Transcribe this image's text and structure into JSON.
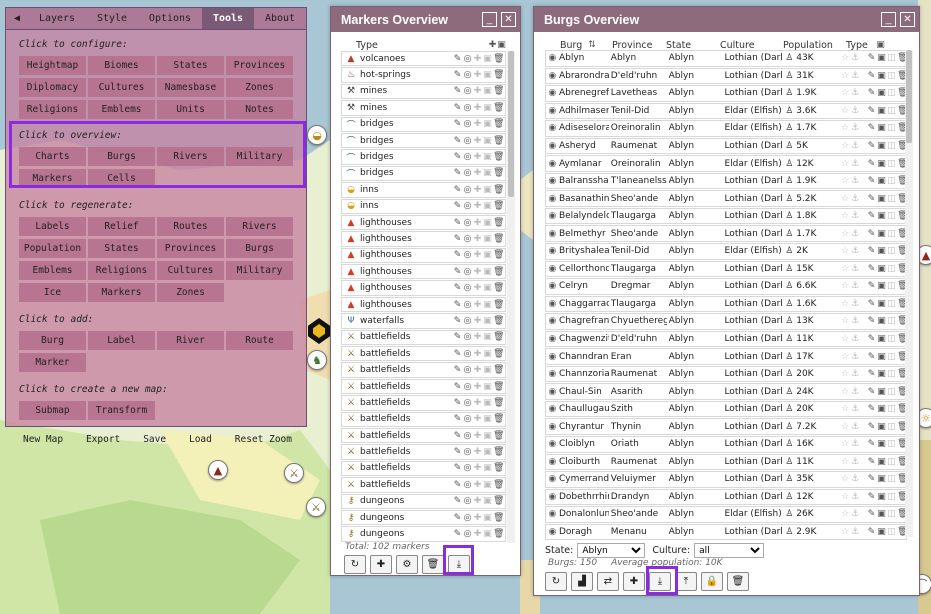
{
  "tools": {
    "tabs": [
      {
        "label": "◀"
      },
      {
        "label": "Layers"
      },
      {
        "label": "Style"
      },
      {
        "label": "Options"
      },
      {
        "label": "Tools"
      },
      {
        "label": "About"
      }
    ],
    "configure_title": "Click to configure:",
    "configure": [
      "Heightmap",
      "Biomes",
      "States",
      "Provinces",
      "Diplomacy",
      "Cultures",
      "Namesbase",
      "Zones",
      "Religions",
      "Emblems",
      "Units",
      "Notes"
    ],
    "overview_title": "Click to overview:",
    "overview": [
      "Charts",
      "Burgs",
      "Rivers",
      "Military",
      "Markers",
      "Cells"
    ],
    "regenerate_title": "Click to regenerate:",
    "regenerate": [
      "Labels",
      "Relief",
      "Routes",
      "Rivers",
      "Population",
      "States",
      "Provinces",
      "Burgs",
      "Emblems",
      "Religions",
      "Cultures",
      "Military",
      "Ice",
      "Markers",
      "Zones"
    ],
    "add_title": "Click to add:",
    "add": [
      "Burg",
      "Label",
      "River",
      "Route",
      "Marker"
    ],
    "newmap_title": "Click to create a new map:",
    "newmap": [
      "Submap",
      "Transform"
    ],
    "bottom": [
      "New Map",
      "Export",
      "Save",
      "Load",
      "Reset Zoom"
    ]
  },
  "markers": {
    "title": "Markers Overview",
    "header_type": "Type",
    "items": [
      {
        "icon": "▲",
        "color": "#c0392b",
        "type": "volcanoes"
      },
      {
        "icon": "♨",
        "color": "#8e2c1e",
        "type": "hot-springs"
      },
      {
        "icon": "⚒",
        "color": "#444444",
        "type": "mines"
      },
      {
        "icon": "⚒",
        "color": "#444444",
        "type": "mines"
      },
      {
        "icon": "⌒",
        "color": "#2c5d7c",
        "type": "bridges"
      },
      {
        "icon": "⌒",
        "color": "#2c5d7c",
        "type": "bridges"
      },
      {
        "icon": "⌒",
        "color": "#2c5d7c",
        "type": "bridges"
      },
      {
        "icon": "⌒",
        "color": "#2c5d7c",
        "type": "bridges"
      },
      {
        "icon": "◒",
        "color": "#d4a017",
        "type": "inns"
      },
      {
        "icon": "◒",
        "color": "#d4a017",
        "type": "inns"
      },
      {
        "icon": "▲",
        "color": "#d33b2c",
        "type": "lighthouses"
      },
      {
        "icon": "▲",
        "color": "#d33b2c",
        "type": "lighthouses"
      },
      {
        "icon": "▲",
        "color": "#d33b2c",
        "type": "lighthouses"
      },
      {
        "icon": "▲",
        "color": "#d33b2c",
        "type": "lighthouses"
      },
      {
        "icon": "▲",
        "color": "#d33b2c",
        "type": "lighthouses"
      },
      {
        "icon": "▲",
        "color": "#d33b2c",
        "type": "lighthouses"
      },
      {
        "icon": "Ψ",
        "color": "#3a6ea5",
        "type": "waterfalls"
      },
      {
        "icon": "⚔",
        "color": "#7a5c2e",
        "type": "battlefields"
      },
      {
        "icon": "⚔",
        "color": "#7a5c2e",
        "type": "battlefields"
      },
      {
        "icon": "⚔",
        "color": "#7a5c2e",
        "type": "battlefields"
      },
      {
        "icon": "⚔",
        "color": "#7a5c2e",
        "type": "battlefields"
      },
      {
        "icon": "⚔",
        "color": "#7a5c2e",
        "type": "battlefields"
      },
      {
        "icon": "⚔",
        "color": "#7a5c2e",
        "type": "battlefields"
      },
      {
        "icon": "⚔",
        "color": "#7a5c2e",
        "type": "battlefields"
      },
      {
        "icon": "⚔",
        "color": "#7a5c2e",
        "type": "battlefields"
      },
      {
        "icon": "⚔",
        "color": "#7a5c2e",
        "type": "battlefields"
      },
      {
        "icon": "⚔",
        "color": "#7a5c2e",
        "type": "battlefields"
      },
      {
        "icon": "⚷",
        "color": "#8a6d1e",
        "type": "dungeons"
      },
      {
        "icon": "⚷",
        "color": "#8a6d1e",
        "type": "dungeons"
      },
      {
        "icon": "⚷",
        "color": "#8a6d1e",
        "type": "dungeons"
      }
    ],
    "total": "Total: 102 markers"
  },
  "burgs": {
    "title": "Burgs Overview",
    "headers": {
      "burg": "Burg",
      "province": "Province",
      "state": "State",
      "culture": "Culture",
      "population": "Population",
      "type": "Type"
    },
    "rows": [
      {
        "burg": "Ablyn",
        "province": "Ablyn",
        "state": "Ablyn",
        "culture": "Lothian (Dark E",
        "pop": "43K"
      },
      {
        "burg": "Abrarondras",
        "province": "D'eld'ruhn",
        "state": "Ablyn",
        "culture": "Lothian (Dark E",
        "pop": "31K"
      },
      {
        "burg": "Abrenegref",
        "province": "Lavetheas",
        "state": "Ablyn",
        "culture": "Lothian (Dark E",
        "pop": "1.9K"
      },
      {
        "burg": "Adhilmasene",
        "province": "Tenil-Did",
        "state": "Ablyn",
        "culture": "Eldar (Elfish)",
        "pop": "3.6K"
      },
      {
        "burg": "Adiseselora",
        "province": "Oreinoralin",
        "state": "Ablyn",
        "culture": "Eldar (Elfish)",
        "pop": "1.7K"
      },
      {
        "burg": "Asheryd",
        "province": "Raumenat",
        "state": "Ablyn",
        "culture": "Lothian (Dark E",
        "pop": "5K"
      },
      {
        "burg": "Aymlanar",
        "province": "Oreinoralin",
        "state": "Ablyn",
        "culture": "Eldar (Elfish)",
        "pop": "12K"
      },
      {
        "burg": "Balransshar",
        "province": "T'laneanelss",
        "state": "Ablyn",
        "culture": "Lothian (Dark E",
        "pop": "1.9K"
      },
      {
        "burg": "Basanathinn",
        "province": "Sheo'ande",
        "state": "Ablyn",
        "culture": "Lothian (Dark E",
        "pop": "5.2K"
      },
      {
        "burg": "Belalyndelo",
        "province": "Tlaugarga",
        "state": "Ablyn",
        "culture": "Lothian (Dark E",
        "pop": "1.8K"
      },
      {
        "burg": "Belmethyr",
        "province": "Sheo'ande",
        "state": "Ablyn",
        "culture": "Lothian (Dark E",
        "pop": "1.7K"
      },
      {
        "burg": "Brityshalean",
        "province": "Tenil-Did",
        "state": "Ablyn",
        "culture": "Eldar (Elfish)",
        "pop": "2K"
      },
      {
        "burg": "Cellorthond",
        "province": "Tlaugarga",
        "state": "Ablyn",
        "culture": "Lothian (Dark E",
        "pop": "15K"
      },
      {
        "burg": "Celryn",
        "province": "Dregmar",
        "state": "Ablyn",
        "culture": "Lothian (Dark E",
        "pop": "6.6K"
      },
      {
        "burg": "Chaggarradi",
        "province": "Tlaugarga",
        "state": "Ablyn",
        "culture": "Lothian (Dark E",
        "pop": "1.6K"
      },
      {
        "burg": "Chagrefrant",
        "province": "Chyuethereg",
        "state": "Ablyn",
        "culture": "Lothian (Dark E",
        "pop": "13K"
      },
      {
        "burg": "Chagwenzitl",
        "province": "D'eld'ruhn",
        "state": "Ablyn",
        "culture": "Lothian (Dark E",
        "pop": "11K"
      },
      {
        "burg": "Channdrane",
        "province": "Eran",
        "state": "Ablyn",
        "culture": "Lothian (Dark E",
        "pop": "17K"
      },
      {
        "burg": "Channzoriat",
        "province": "Raumenat",
        "state": "Ablyn",
        "culture": "Lothian (Dark E",
        "pop": "20K"
      },
      {
        "burg": "Chaul-Sin",
        "province": "Asarith",
        "state": "Ablyn",
        "culture": "Lothian (Dark E",
        "pop": "24K"
      },
      {
        "burg": "Chaullugaut",
        "province": "Szith",
        "state": "Ablyn",
        "culture": "Lothian (Dark E",
        "pop": "20K"
      },
      {
        "burg": "Chyrantur",
        "province": "Thynin",
        "state": "Ablyn",
        "culture": "Lothian (Dark E",
        "pop": "7.2K"
      },
      {
        "burg": "Cloiblyn",
        "province": "Oriath",
        "state": "Ablyn",
        "culture": "Lothian (Dark E",
        "pop": "16K"
      },
      {
        "burg": "Cloiburth",
        "province": "Raumenat",
        "state": "Ablyn",
        "culture": "Lothian (Dark E",
        "pop": "11K"
      },
      {
        "burg": "Cymerrando",
        "province": "Veluiymer",
        "state": "Ablyn",
        "culture": "Lothian (Dark E",
        "pop": "35K"
      },
      {
        "burg": "Dobethrrhin",
        "province": "Drandyn",
        "state": "Ablyn",
        "culture": "Lothian (Dark E",
        "pop": "12K"
      },
      {
        "burg": "Donalonluna",
        "province": "Sheo'ande",
        "state": "Ablyn",
        "culture": "Eldar (Elfish)",
        "pop": "26K"
      },
      {
        "burg": "Doragh",
        "province": "Menanu",
        "state": "Ablyn",
        "culture": "Lothian (Dark E",
        "pop": "2.9K"
      }
    ],
    "filter_state_label": "State:",
    "filter_state_value": "Ablyn",
    "filter_culture_label": "Culture:",
    "filter_culture_value": "all",
    "count": "Burgs: 150",
    "avg_pop": "Average population: 10K"
  },
  "colors": {
    "accent": "#8a2be2",
    "titlebar": "#8d6b7d",
    "tools_bg": "#c682a0"
  }
}
